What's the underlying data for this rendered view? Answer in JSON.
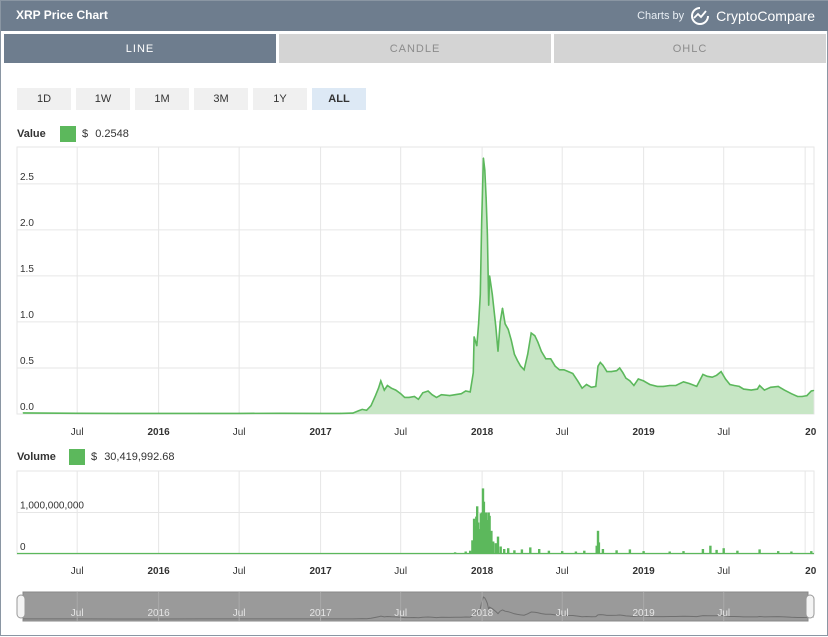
{
  "header": {
    "title": "XRP Price Chart",
    "charts_by": "Charts by",
    "brand": "CryptoCompare"
  },
  "tabs": [
    {
      "label": "LINE"
    },
    {
      "label": "CANDLE"
    },
    {
      "label": "OHLC"
    }
  ],
  "active_tab": "LINE",
  "ranges": [
    {
      "label": "1D"
    },
    {
      "label": "1W"
    },
    {
      "label": "1M"
    },
    {
      "label": "3M"
    },
    {
      "label": "1Y"
    },
    {
      "label": "ALL"
    }
  ],
  "active_range": "ALL",
  "value_legend": {
    "label": "Value",
    "currency": "$",
    "amount": "0.2548"
  },
  "volume_legend": {
    "label": "Volume",
    "currency": "$",
    "amount": "30,419,992.68"
  },
  "colors": {
    "series": "#5cb85c",
    "fill": "#c7e6c5",
    "header": "#6e7d8e"
  },
  "chart_data": [
    {
      "type": "area",
      "name": "Value",
      "x_ticks": [
        "Jul",
        "2016",
        "Jul",
        "2017",
        "Jul",
        "2018",
        "Jul",
        "2019",
        "Jul",
        "20"
      ],
      "y_ticks": [
        "0.0",
        "0.5",
        "1.0",
        "1.5",
        "2.0",
        "2.5"
      ],
      "ylim": [
        0,
        2.9
      ],
      "xlim": [
        "2015-03",
        "2020-01"
      ],
      "grid": true,
      "points": [
        [
          "2015-03-01",
          0.012
        ],
        [
          "2015-07-01",
          0.008
        ],
        [
          "2015-10-01",
          0.006
        ],
        [
          "2016-01-01",
          0.006
        ],
        [
          "2016-04-01",
          0.007
        ],
        [
          "2016-07-01",
          0.007
        ],
        [
          "2016-10-01",
          0.008
        ],
        [
          "2017-01-01",
          0.0065
        ],
        [
          "2017-02-15",
          0.007
        ],
        [
          "2017-03-15",
          0.01
        ],
        [
          "2017-03-28",
          0.035
        ],
        [
          "2017-04-05",
          0.05
        ],
        [
          "2017-04-15",
          0.04
        ],
        [
          "2017-04-25",
          0.09
        ],
        [
          "2017-05-05",
          0.2
        ],
        [
          "2017-05-12",
          0.28
        ],
        [
          "2017-05-17",
          0.36
        ],
        [
          "2017-05-25",
          0.26
        ],
        [
          "2017-06-01",
          0.31
        ],
        [
          "2017-06-10",
          0.28
        ],
        [
          "2017-06-20",
          0.26
        ],
        [
          "2017-07-01",
          0.22
        ],
        [
          "2017-07-10",
          0.18
        ],
        [
          "2017-07-20",
          0.18
        ],
        [
          "2017-08-01",
          0.19
        ],
        [
          "2017-08-10",
          0.16
        ],
        [
          "2017-08-20",
          0.23
        ],
        [
          "2017-09-01",
          0.25
        ],
        [
          "2017-09-10",
          0.21
        ],
        [
          "2017-09-20",
          0.18
        ],
        [
          "2017-10-01",
          0.21
        ],
        [
          "2017-10-20",
          0.2
        ],
        [
          "2017-11-01",
          0.21
        ],
        [
          "2017-11-15",
          0.22
        ],
        [
          "2017-11-25",
          0.25
        ],
        [
          "2017-12-05",
          0.24
        ],
        [
          "2017-12-12",
          0.45
        ],
        [
          "2017-12-14",
          0.84
        ],
        [
          "2017-12-20",
          0.74
        ],
        [
          "2017-12-24",
          0.98
        ],
        [
          "2017-12-28",
          1.3
        ],
        [
          "2017-12-31",
          2.1
        ],
        [
          "2018-01-04",
          2.78
        ],
        [
          "2018-01-07",
          2.65
        ],
        [
          "2018-01-10",
          2.35
        ],
        [
          "2018-01-13",
          1.95
        ],
        [
          "2018-01-16",
          1.18
        ],
        [
          "2018-01-18",
          1.5
        ],
        [
          "2018-01-24",
          1.3
        ],
        [
          "2018-02-01",
          0.95
        ],
        [
          "2018-02-06",
          0.68
        ],
        [
          "2018-02-11",
          1.0
        ],
        [
          "2018-02-16",
          1.15
        ],
        [
          "2018-02-22",
          0.98
        ],
        [
          "2018-03-01",
          0.92
        ],
        [
          "2018-03-08",
          0.8
        ],
        [
          "2018-03-15",
          0.65
        ],
        [
          "2018-03-22",
          0.58
        ],
        [
          "2018-03-29",
          0.52
        ],
        [
          "2018-04-06",
          0.48
        ],
        [
          "2018-04-14",
          0.65
        ],
        [
          "2018-04-22",
          0.88
        ],
        [
          "2018-04-30",
          0.85
        ],
        [
          "2018-05-07",
          0.78
        ],
        [
          "2018-05-15",
          0.68
        ],
        [
          "2018-05-25",
          0.6
        ],
        [
          "2018-06-05",
          0.6
        ],
        [
          "2018-06-15",
          0.52
        ],
        [
          "2018-06-25",
          0.48
        ],
        [
          "2018-07-05",
          0.48
        ],
        [
          "2018-07-15",
          0.46
        ],
        [
          "2018-07-25",
          0.44
        ],
        [
          "2018-08-05",
          0.36
        ],
        [
          "2018-08-15",
          0.28
        ],
        [
          "2018-08-25",
          0.32
        ],
        [
          "2018-09-05",
          0.29
        ],
        [
          "2018-09-15",
          0.3
        ],
        [
          "2018-09-20",
          0.52
        ],
        [
          "2018-09-25",
          0.56
        ],
        [
          "2018-10-01",
          0.53
        ],
        [
          "2018-10-10",
          0.46
        ],
        [
          "2018-10-20",
          0.46
        ],
        [
          "2018-11-01",
          0.47
        ],
        [
          "2018-11-08",
          0.5
        ],
        [
          "2018-11-15",
          0.45
        ],
        [
          "2018-11-22",
          0.39
        ],
        [
          "2018-12-01",
          0.36
        ],
        [
          "2018-12-10",
          0.31
        ],
        [
          "2018-12-20",
          0.38
        ],
        [
          "2019-01-01",
          0.36
        ],
        [
          "2019-01-15",
          0.32
        ],
        [
          "2019-02-01",
          0.3
        ],
        [
          "2019-02-15",
          0.3
        ],
        [
          "2019-03-01",
          0.31
        ],
        [
          "2019-03-15",
          0.31
        ],
        [
          "2019-04-01",
          0.35
        ],
        [
          "2019-04-15",
          0.33
        ],
        [
          "2019-05-01",
          0.3
        ],
        [
          "2019-05-15",
          0.43
        ],
        [
          "2019-05-25",
          0.41
        ],
        [
          "2019-06-05",
          0.4
        ],
        [
          "2019-06-15",
          0.42
        ],
        [
          "2019-06-25",
          0.46
        ],
        [
          "2019-07-05",
          0.38
        ],
        [
          "2019-07-15",
          0.32
        ],
        [
          "2019-07-25",
          0.31
        ],
        [
          "2019-08-05",
          0.3
        ],
        [
          "2019-08-15",
          0.27
        ],
        [
          "2019-09-01",
          0.26
        ],
        [
          "2019-09-15",
          0.27
        ],
        [
          "2019-09-20",
          0.31
        ],
        [
          "2019-10-01",
          0.26
        ],
        [
          "2019-10-15",
          0.29
        ],
        [
          "2019-11-01",
          0.3
        ],
        [
          "2019-11-15",
          0.26
        ],
        [
          "2019-12-01",
          0.22
        ],
        [
          "2019-12-15",
          0.19
        ],
        [
          "2019-12-25",
          0.19
        ],
        [
          "2020-01-05",
          0.2
        ],
        [
          "2020-01-15",
          0.25
        ],
        [
          "2020-01-20",
          0.2548
        ]
      ]
    },
    {
      "type": "bar",
      "name": "Volume",
      "x_ticks": [
        "Jul",
        "2016",
        "Jul",
        "2017",
        "Jul",
        "2018",
        "Jul",
        "2019",
        "Jul",
        "20"
      ],
      "y_ticks": [
        "0",
        "1,000,000,000"
      ],
      "ylim": [
        0,
        2000000000
      ],
      "grid": true,
      "points": [
        [
          "2017-04-01",
          8000000
        ],
        [
          "2017-05-15",
          25000000
        ],
        [
          "2017-06-01",
          18000000
        ],
        [
          "2017-07-01",
          12000000
        ],
        [
          "2017-08-01",
          14000000
        ],
        [
          "2017-09-01",
          20000000
        ],
        [
          "2017-10-01",
          25000000
        ],
        [
          "2017-11-01",
          40000000
        ],
        [
          "2017-11-25",
          60000000
        ],
        [
          "2017-12-05",
          80000000
        ],
        [
          "2017-12-10",
          330000000
        ],
        [
          "2017-12-14",
          850000000
        ],
        [
          "2017-12-16",
          680000000
        ],
        [
          "2017-12-19",
          900000000
        ],
        [
          "2017-12-21",
          1150000000
        ],
        [
          "2017-12-23",
          760000000
        ],
        [
          "2017-12-26",
          600000000
        ],
        [
          "2017-12-29",
          980000000
        ],
        [
          "2018-01-01",
          1000000000
        ],
        [
          "2018-01-03",
          1580000000
        ],
        [
          "2018-01-05",
          1260000000
        ],
        [
          "2018-01-08",
          700000000
        ],
        [
          "2018-01-10",
          1000000000
        ],
        [
          "2018-01-13",
          820000000
        ],
        [
          "2018-01-16",
          1000000000
        ],
        [
          "2018-01-18",
          920000000
        ],
        [
          "2018-01-22",
          560000000
        ],
        [
          "2018-01-26",
          300000000
        ],
        [
          "2018-02-01",
          260000000
        ],
        [
          "2018-02-06",
          420000000
        ],
        [
          "2018-02-12",
          180000000
        ],
        [
          "2018-02-20",
          120000000
        ],
        [
          "2018-03-01",
          140000000
        ],
        [
          "2018-03-15",
          90000000
        ],
        [
          "2018-04-01",
          110000000
        ],
        [
          "2018-04-20",
          160000000
        ],
        [
          "2018-05-10",
          120000000
        ],
        [
          "2018-06-01",
          80000000
        ],
        [
          "2018-07-01",
          70000000
        ],
        [
          "2018-08-01",
          60000000
        ],
        [
          "2018-08-20",
          80000000
        ],
        [
          "2018-09-17",
          200000000
        ],
        [
          "2018-09-20",
          560000000
        ],
        [
          "2018-09-22",
          280000000
        ],
        [
          "2018-10-01",
          120000000
        ],
        [
          "2018-11-01",
          90000000
        ],
        [
          "2018-12-01",
          110000000
        ],
        [
          "2019-01-01",
          70000000
        ],
        [
          "2019-03-01",
          60000000
        ],
        [
          "2019-04-01",
          70000000
        ],
        [
          "2019-05-15",
          120000000
        ],
        [
          "2019-06-01",
          200000000
        ],
        [
          "2019-06-15",
          100000000
        ],
        [
          "2019-07-01",
          140000000
        ],
        [
          "2019-08-01",
          80000000
        ],
        [
          "2019-09-20",
          110000000
        ],
        [
          "2019-11-01",
          70000000
        ],
        [
          "2019-12-01",
          60000000
        ],
        [
          "2020-01-15",
          70000000
        ]
      ]
    }
  ],
  "navigator": {
    "x_ticks": [
      "Jul",
      "2016",
      "Jul",
      "2017",
      "Jul",
      "2018",
      "Jul",
      "2019",
      "Jul"
    ]
  }
}
